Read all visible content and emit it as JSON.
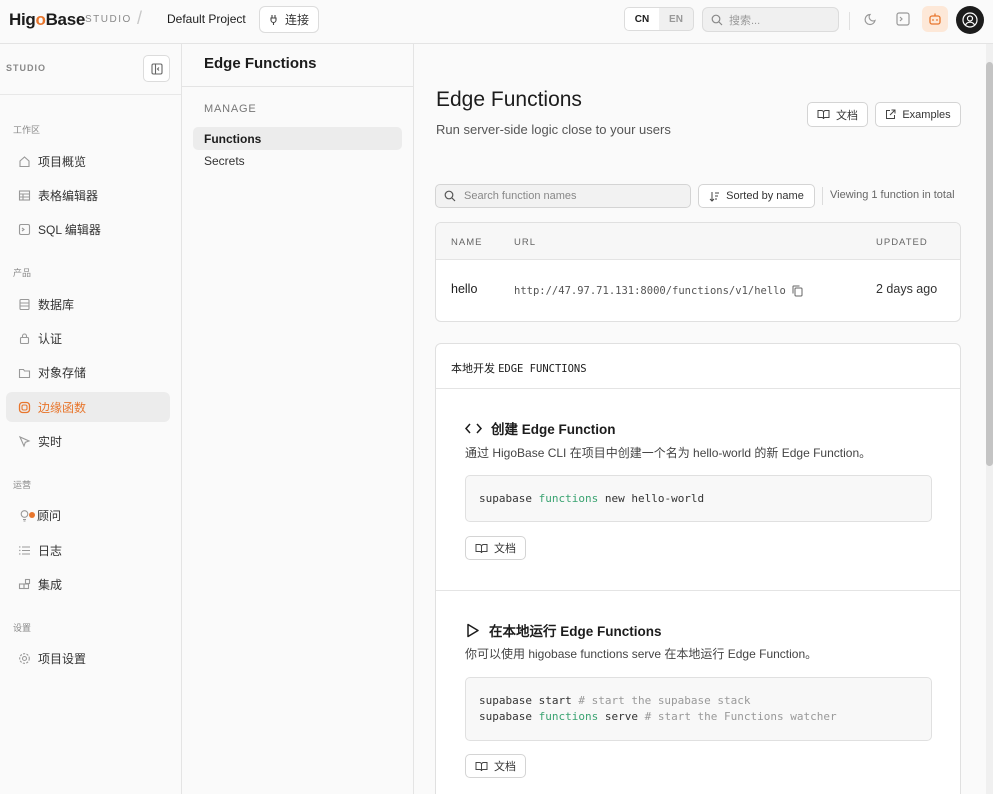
{
  "topbar": {
    "logo_prefix": "Hig",
    "logo_o": "o",
    "logo_suffix": "Base",
    "studio": "STUDIO",
    "slash": "/",
    "project": "Default Project",
    "connect": "连接",
    "lang_cn": "CN",
    "lang_en": "EN",
    "search_placeholder": "搜索..."
  },
  "sidebar": {
    "studio": "STUDIO",
    "sections": {
      "workspace": "工作区",
      "products": "产品",
      "ops": "运营",
      "settings": "设置"
    },
    "items": {
      "overview": "项目概览",
      "table_editor": "表格编辑器",
      "sql_editor": "SQL 编辑器",
      "database": "数据库",
      "auth": "认证",
      "storage": "对象存储",
      "edge": "边缘函数",
      "realtime": "实时",
      "advisor": "顾问",
      "logs": "日志",
      "integrations": "集成",
      "project_settings": "项目设置"
    }
  },
  "subnav": {
    "title": "Edge Functions",
    "section": "MANAGE",
    "items": [
      "Functions",
      "Secrets"
    ]
  },
  "main": {
    "title": "Edge Functions",
    "subtitle": "Run server-side logic close to your users",
    "docs_button": "文档",
    "examples_button": "Examples",
    "search_placeholder": "Search function names",
    "sort_button": "Sorted by name",
    "viewing": "Viewing 1 function in total",
    "table": {
      "headers": [
        "NAME",
        "URL",
        "UPDATED"
      ],
      "rows": [
        {
          "name": "hello",
          "url": "http://47.97.71.131:8000/functions/v1/hello",
          "updated": "2 days ago"
        }
      ]
    },
    "local": {
      "title_cn": "本地开发",
      "title_mono": "EDGE FUNCTIONS",
      "step1": {
        "title": "创建 Edge Function",
        "desc": "通过 HigoBase CLI 在项目中创建一个名为 hello-world 的新 Edge Function。",
        "code_a": "supabase ",
        "code_kw": "functions",
        "code_b": " new hello-world",
        "doc": "文档"
      },
      "step2": {
        "title": "在本地运行 Edge Functions",
        "desc": "你可以使用 higobase functions serve 在本地运行 Edge Function。",
        "l1_a": "supabase start ",
        "l1_c": "# start the supabase stack",
        "l2_a": "supabase ",
        "l2_kw": "functions",
        "l2_b": " serve ",
        "l2_c": "# start the Functions watcher",
        "doc": "文档"
      }
    }
  },
  "colors": {
    "accent": "#e8762d",
    "code_keyword": "#3aa371"
  }
}
